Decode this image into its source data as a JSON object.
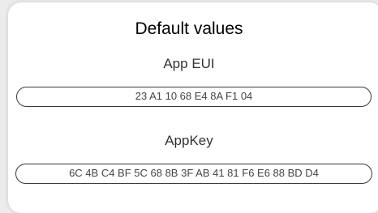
{
  "panel": {
    "title": "Default values",
    "app_eui": {
      "label": "App EUI",
      "value": "23 A1 10 68 E4 8A F1 04"
    },
    "app_key": {
      "label": "AppKey",
      "value": "6C 4B C4 BF 5C 68 8B 3F AB 41 81 F6 E6 88 BD D4"
    }
  }
}
